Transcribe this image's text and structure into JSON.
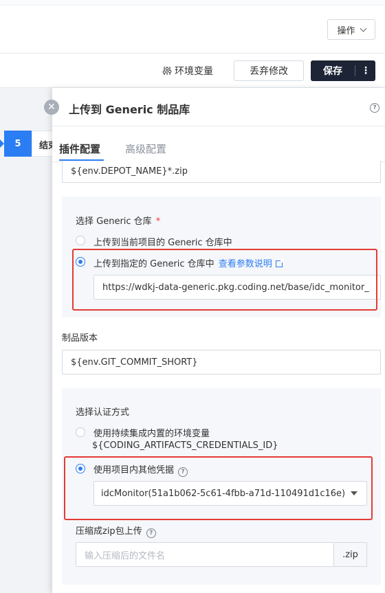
{
  "header": {
    "operate_label": "操作",
    "env_var_label": "环境变量",
    "discard_label": "丢弃修改",
    "save_label": "保存",
    "more_glyph": "⋮"
  },
  "stage": {
    "number": "5",
    "name": "结束"
  },
  "drawer": {
    "title": "上传到 Generic 制品库",
    "tabs": [
      {
        "label": "插件配置",
        "active": true
      },
      {
        "label": "高级配置",
        "active": false
      }
    ],
    "filename_value": "${env.DEPOT_NAME}*.zip",
    "repo_group": {
      "label": "选择 Generic 仓库",
      "required_mark": "*",
      "option_current": "上传到当前项目的 Generic 仓库中",
      "option_specified": "上传到指定的 Generic 仓库中",
      "doc_link": "查看参数说明",
      "repo_url_value": "https://wdkj-data-generic.pkg.coding.net/base/idc_monitor_"
    },
    "version": {
      "label": "制品版本",
      "value": "${env.GIT_COMMIT_SHORT}"
    },
    "auth_group": {
      "label": "选择认证方式",
      "option_builtin": "使用持续集成内置的环境变量",
      "option_builtin_sub": "${CODING_ARTIFACTS_CREDENTIALS_ID}",
      "option_project": "使用项目内其他凭据",
      "credential_value": "idcMonitor(51a1b062-5c61-4fbb-a71d-110491d1c16e)",
      "compress_label": "压缩成zip包上传",
      "compress_placeholder": "输入压缩后的文件名",
      "compress_suffix": ".zip"
    }
  },
  "colors": {
    "accent": "#2b7df3",
    "highlight_red": "#e53935",
    "save_button_bg": "#1c2435"
  }
}
